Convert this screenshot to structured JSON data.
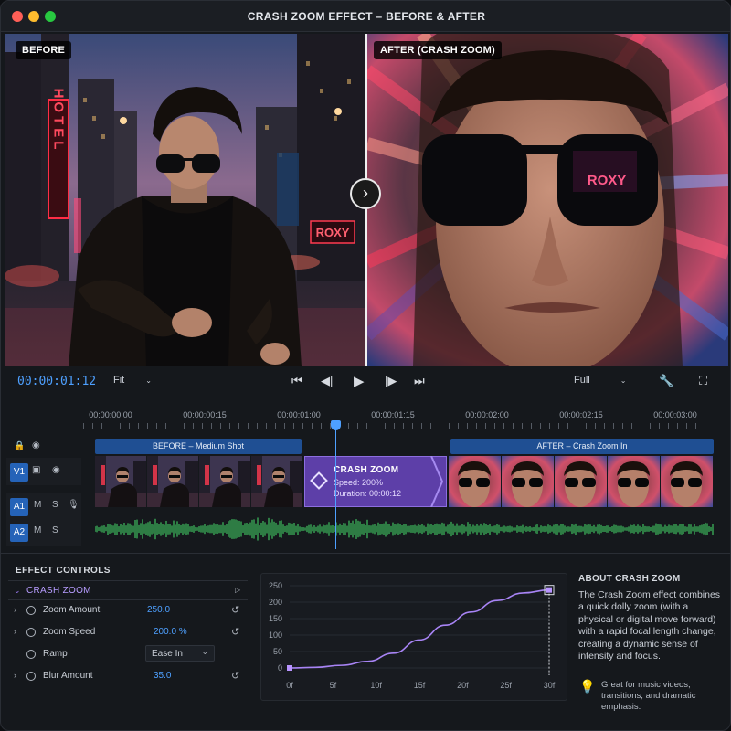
{
  "window": {
    "title": "CRASH ZOOM EFFECT – BEFORE & AFTER"
  },
  "colors": {
    "accent": "#4ea0ff",
    "clip_blue": "#1f4f93",
    "effect_purple": "#5d3fa8",
    "audio_green": "#3fbf5f"
  },
  "viewer": {
    "before_label": "BEFORE",
    "after_label": "AFTER (CRASH ZOOM)",
    "before_sign_hotel": "HOTEL",
    "before_sign_roxy": "ROXY",
    "after_sign_roxy": "ROXY",
    "compare_handle_icon": "chevron-right-icon"
  },
  "transport": {
    "timecode": "00:00:01:12",
    "fit_select": "Fit",
    "quality_select": "Full"
  },
  "timeline": {
    "ruler_labels": [
      "00:00:00:00",
      "00:00:00:15",
      "00:00:01:00",
      "00:00:01:15",
      "00:00:02:00",
      "00:00:02:15",
      "00:00:03:00"
    ],
    "tracks": {
      "v1": "V1",
      "a1": "A1",
      "a2": "A2",
      "mute": "M",
      "solo": "S"
    },
    "clip_before_label": "BEFORE – Medium Shot",
    "clip_after_label": "AFTER – Crash Zoom In",
    "effect_clip": {
      "title": "CRASH ZOOM",
      "speed": "Speed: 200%",
      "duration": "Duration: 00:00:12"
    }
  },
  "effect_controls": {
    "title": "EFFECT CONTROLS",
    "effect_name": "CRASH ZOOM",
    "params": [
      {
        "name": "Zoom Amount",
        "value": "250.0"
      },
      {
        "name": "Zoom Speed",
        "value": "200.0 %"
      },
      {
        "name": "Ramp",
        "value": "Ease In"
      },
      {
        "name": "Blur Amount",
        "value": "35.0"
      }
    ]
  },
  "chart_data": {
    "type": "line",
    "x_ticks": [
      "0f",
      "5f",
      "10f",
      "15f",
      "20f",
      "25f",
      "30f"
    ],
    "y_ticks": [
      "250",
      "200",
      "150",
      "100",
      "50",
      "0"
    ],
    "ylim": [
      0,
      250
    ],
    "xlim": [
      0,
      30
    ],
    "series": [
      {
        "points": [
          [
            0,
            0
          ],
          [
            3,
            2
          ],
          [
            6,
            8
          ],
          [
            9,
            20
          ],
          [
            12,
            45
          ],
          [
            15,
            85
          ],
          [
            18,
            130
          ],
          [
            21,
            170
          ],
          [
            24,
            205
          ],
          [
            27,
            228
          ],
          [
            30,
            237
          ]
        ]
      }
    ],
    "keyframes": [
      [
        0,
        0
      ],
      [
        30,
        237
      ]
    ]
  },
  "about": {
    "title": "ABOUT CRASH ZOOM",
    "description": "The Crash Zoom effect combines a quick dolly zoom (with a physical or digital move forward) with a rapid focal length change, creating a dynamic sense of intensity and focus.",
    "tip": "Great for music videos, transitions, and dramatic emphasis."
  }
}
